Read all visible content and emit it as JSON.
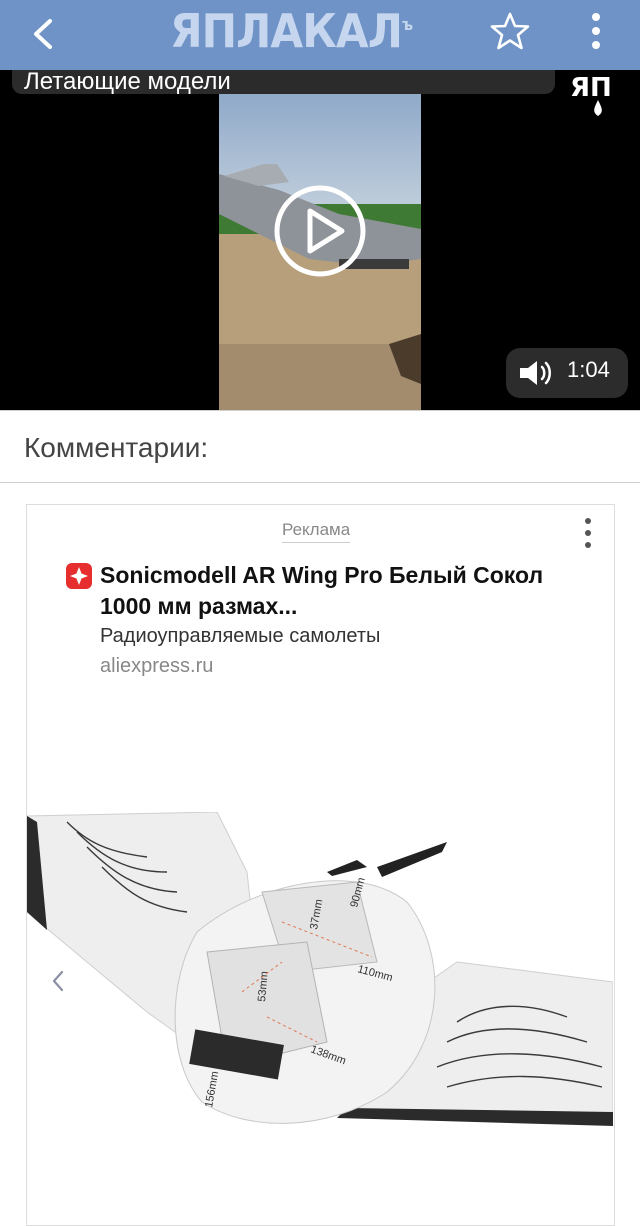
{
  "header": {
    "logo_text": "ЯПЛАКАЛ",
    "logo_suffix": "ъ",
    "back_icon": "chevron-left-icon",
    "star_icon": "star-outline-icon",
    "more_icon": "more-vertical-icon",
    "bg_color": "#6f93c6"
  },
  "video": {
    "title": "Летающие модели",
    "watermark": "ЯП",
    "duration": "1:04",
    "play_icon": "play-circle-icon",
    "sound_icon": "speaker-icon"
  },
  "comments": {
    "title": "Комментарии:"
  },
  "ad": {
    "label": "Реклама",
    "title": "Sonicmodell AR Wing Pro Белый Сокол 1000 мм размах...",
    "subtitle": "Радиоуправляемые самолеты",
    "domain": "aliexpress.ru",
    "brand_color": "#e62e2e",
    "image_labels": [
      "37mm",
      "90mm",
      "110mm",
      "53mm",
      "138mm",
      "156mm"
    ]
  }
}
